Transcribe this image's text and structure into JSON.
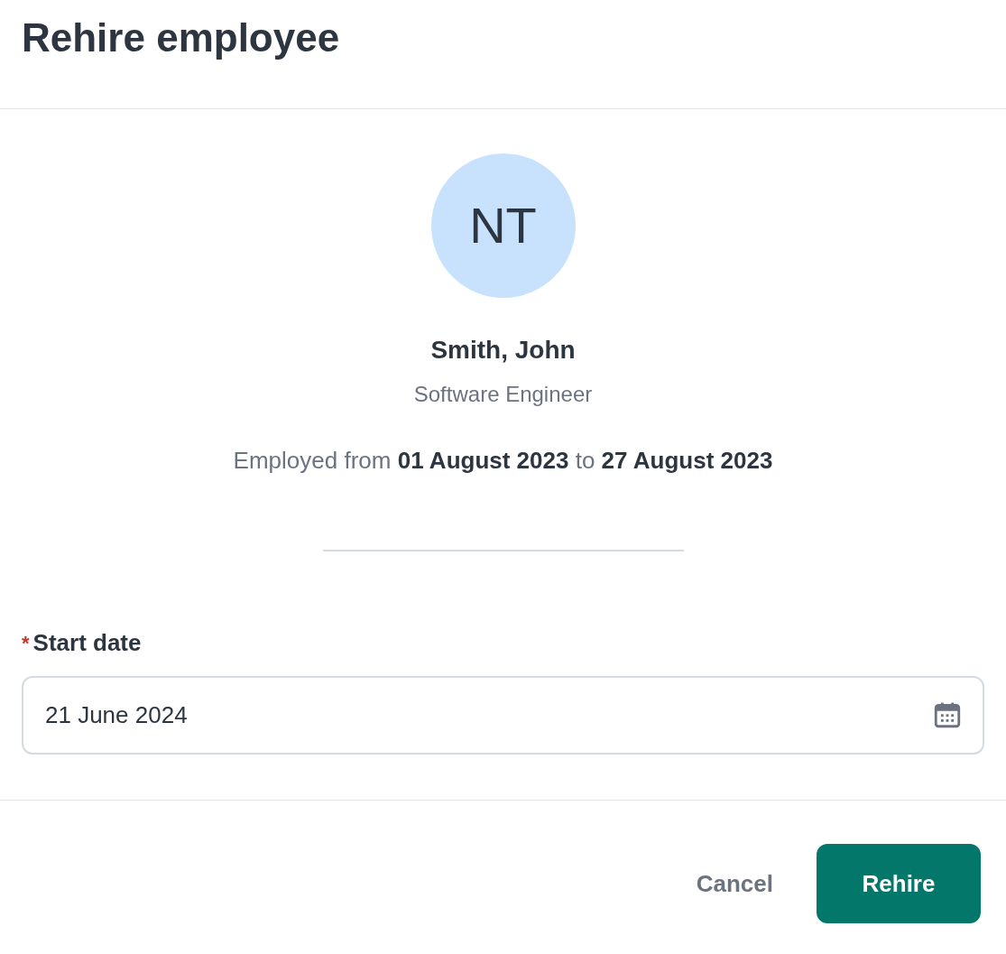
{
  "dialog": {
    "title": "Rehire employee"
  },
  "employee": {
    "initials": "NT",
    "name": "Smith, John",
    "job_title": "Software Engineer",
    "employment": "Employed from **01 August 2023** to **27 August 2023**"
  },
  "start_date": {
    "required_mark": "*",
    "label": "Start date",
    "value": "21 June 2024"
  },
  "buttons": [
    {
      "label": "Cancel",
      "kind": "secondary"
    },
    {
      "label": "Rehire",
      "kind": "primary"
    }
  ]
}
